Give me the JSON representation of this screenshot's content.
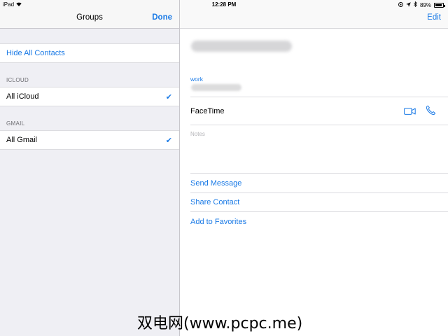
{
  "status_bar": {
    "device": "iPad",
    "time": "12:28 PM",
    "battery": "89%",
    "battery_level": 0.89
  },
  "groups": {
    "title": "Groups",
    "done_label": "Done",
    "hide_all": "Hide All Contacts",
    "sections": [
      {
        "header": "ICLOUD",
        "item": "All iCloud",
        "checked": true
      },
      {
        "header": "GMAIL",
        "item": "All Gmail",
        "checked": true
      }
    ],
    "check_glyph": "✔"
  },
  "contact": {
    "edit_label": "Edit",
    "field_label": "work",
    "facetime_label": "FaceTime",
    "notes_label": "Notes",
    "actions": [
      "Send Message",
      "Share Contact",
      "Add to Favorites"
    ]
  },
  "watermark": "双电网(www.pcpc.me)",
  "colors": {
    "accent": "#1a7ae6",
    "sidebar_bg": "#efeff4"
  },
  "icons": [
    "wifi-icon",
    "location-icon",
    "bluetooth-icon",
    "battery-icon",
    "checkmark-icon",
    "video-camera-icon",
    "phone-icon"
  ]
}
